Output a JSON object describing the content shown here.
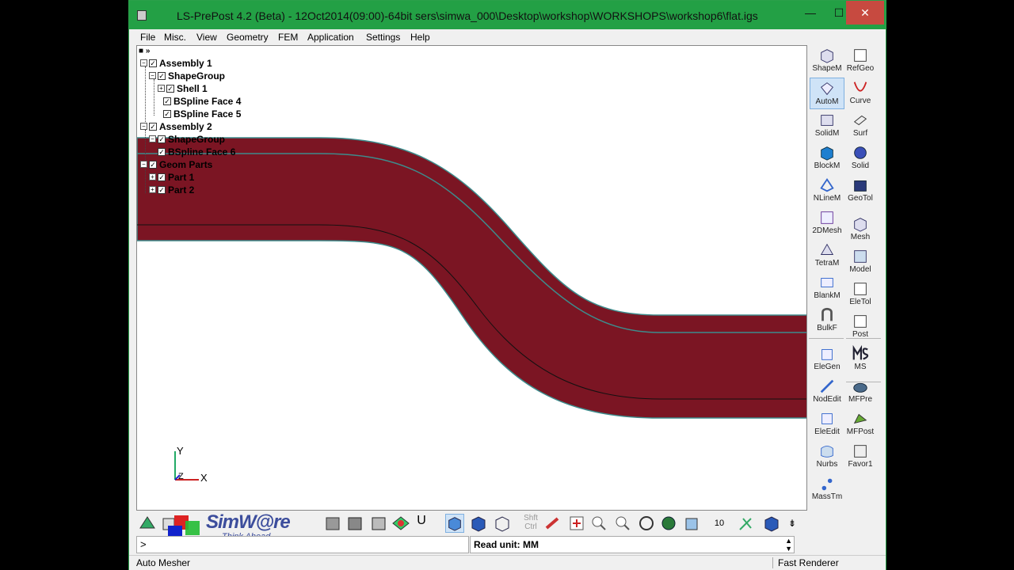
{
  "window": {
    "title": "LS-PrePost 4.2 (Beta) - 12Oct2014(09:00)-64bit sers\\simwa_000\\Desktop\\workshop\\WORKSHOPS\\workshop6\\flat.igs",
    "min": "—",
    "max": "☐",
    "close": "✕"
  },
  "menu": [
    "File",
    "Misc.",
    "View",
    "Geometry",
    "FEM",
    "Application",
    "Settings",
    "Help"
  ],
  "tree": {
    "assembly1": "Assembly 1",
    "shapegroup1": "ShapeGroup",
    "shell1": "Shell 1",
    "face4": "BSpline Face 4",
    "face5": "BSpline Face 5",
    "assembly2": "Assembly 2",
    "shapegroup2": "ShapeGroup",
    "face6": "BSpline Face 6",
    "geomparts": "Geom Parts",
    "part1": "Part 1",
    "part2": "Part 2"
  },
  "axis": {
    "y": "Y",
    "x": "X",
    "z": "Z"
  },
  "tools": {
    "left": [
      "ShapeM",
      "AutoM",
      "SolidM",
      "BlockM",
      "NLineM",
      "2DMesh",
      "TetraM",
      "BlankM",
      "BulkF",
      "EleGen",
      "NodEdit",
      "EleEdit",
      "Nurbs",
      "MassTm"
    ],
    "right": [
      "RefGeo",
      "Curve",
      "Surf",
      "Solid",
      "GeoTol",
      "Mesh",
      "Model",
      "EleTol",
      "Post",
      "MS",
      "MFPre",
      "MFPost",
      "Favor1"
    ]
  },
  "bottombar": {
    "shft": "Shft",
    "ctrl": "Ctrl",
    "zoom": "10",
    "u": "U",
    "more": "⇟"
  },
  "logo": {
    "name": "SimW@re",
    "tagline": "Think Ahead"
  },
  "command": {
    "prompt": ">",
    "read_unit": "Read unit: MM"
  },
  "status": {
    "left": "Auto Mesher",
    "right": "Fast Renderer"
  },
  "colors": {
    "titlebar": "#23a045",
    "part": "#7b1523",
    "edge": "#3d8c8c"
  }
}
